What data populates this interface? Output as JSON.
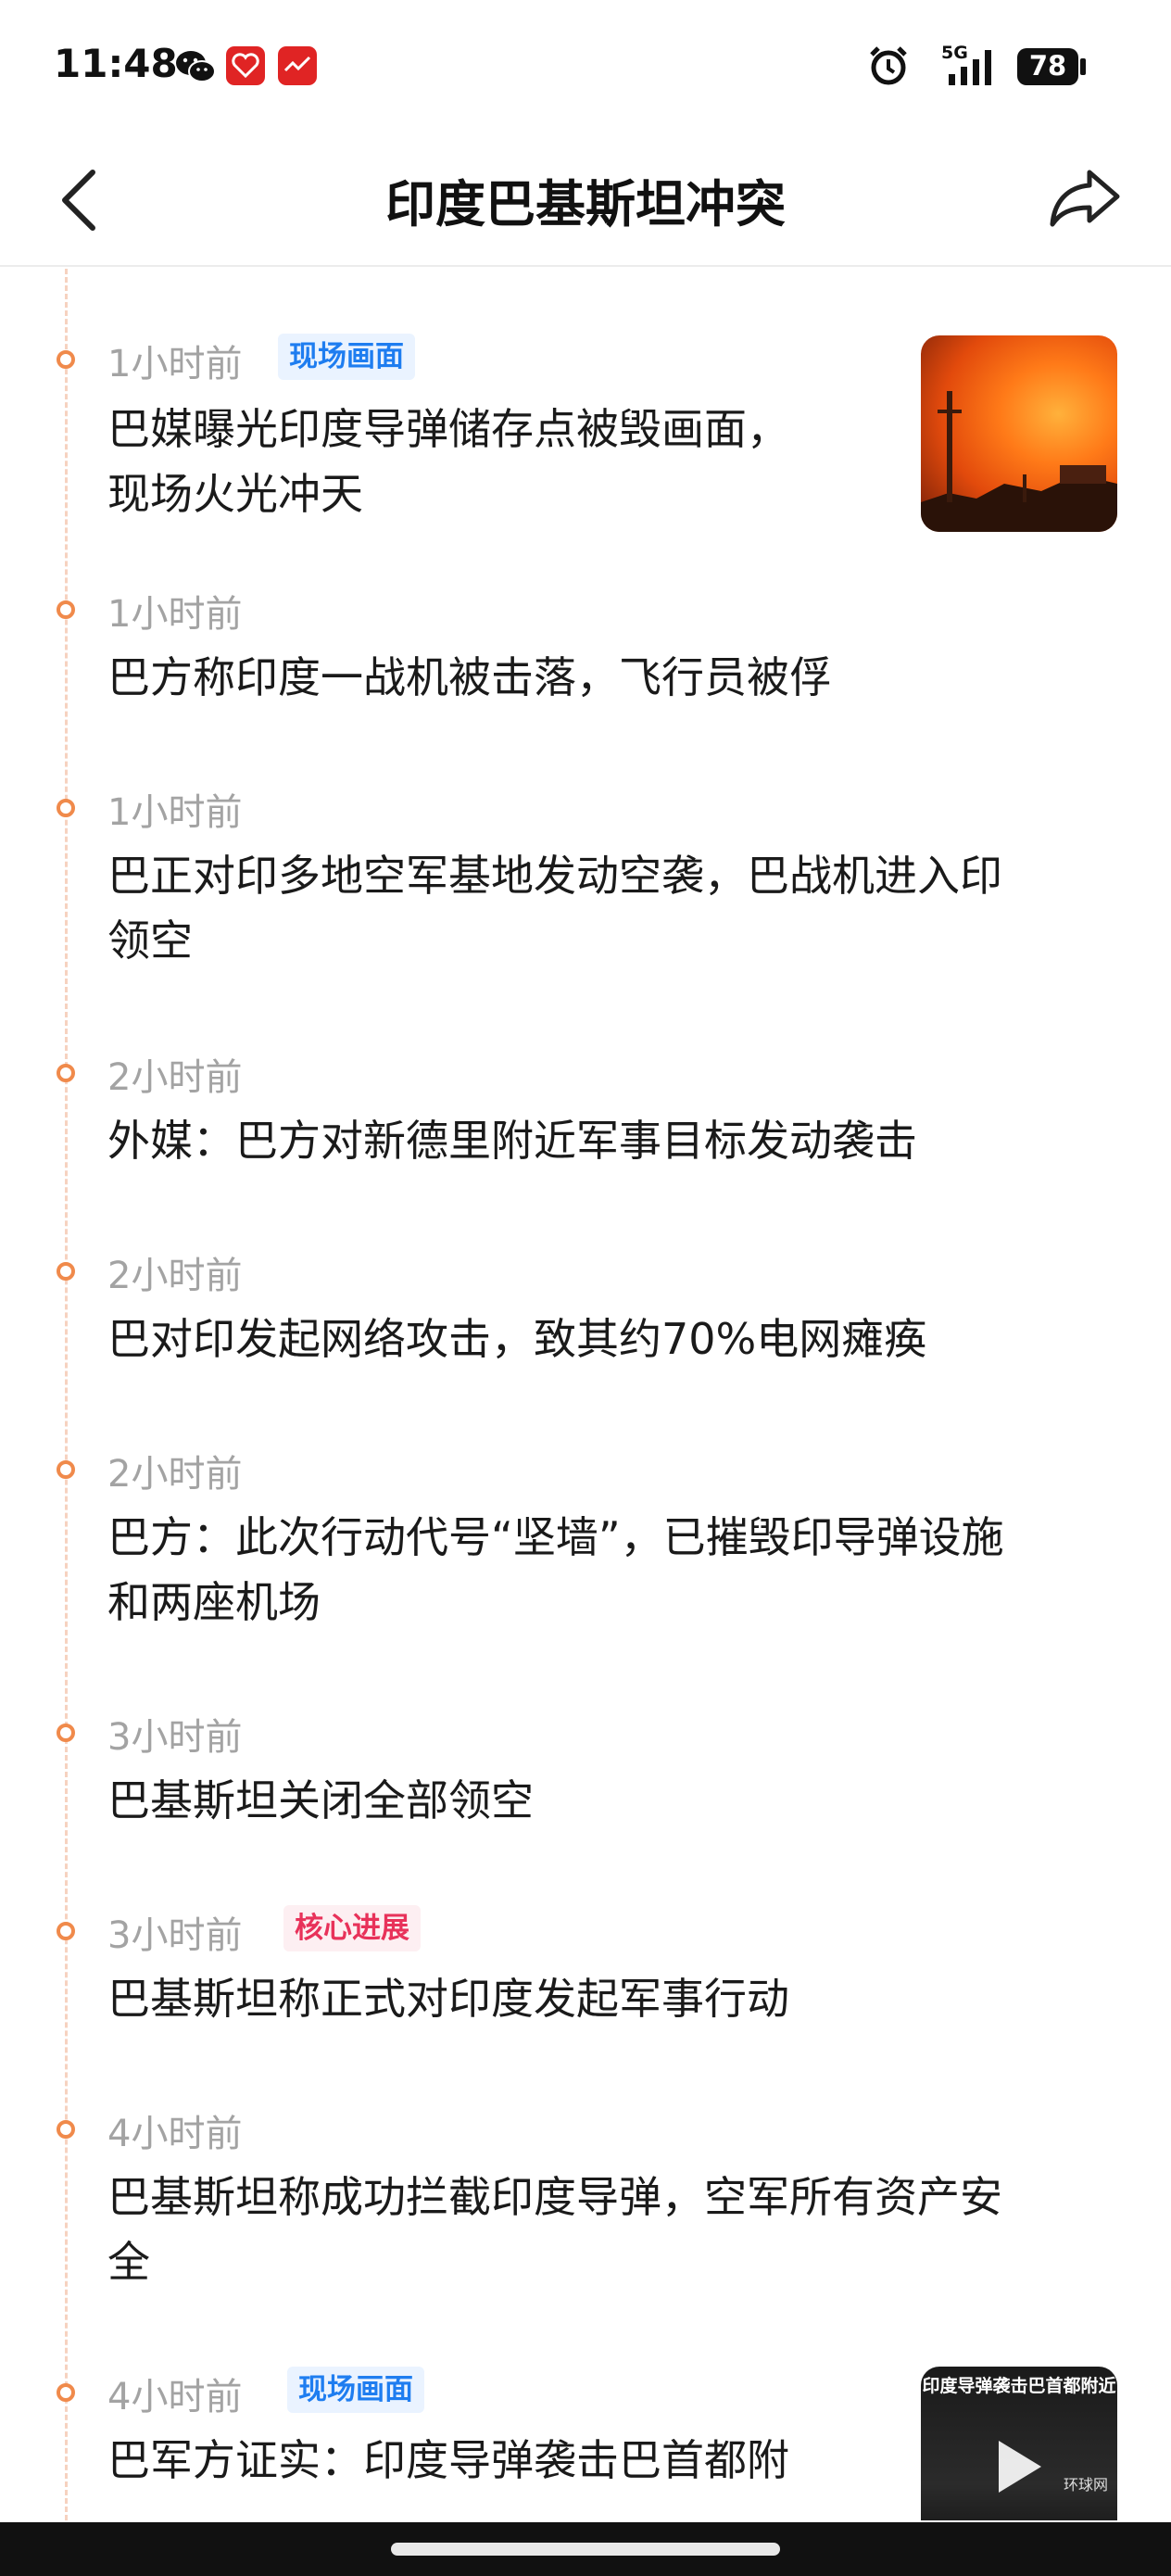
{
  "status_bar": {
    "time": "11:48",
    "network": "5G",
    "battery": "78",
    "icons": [
      "wechat-icon",
      "app-red-icon",
      "app-red-icon",
      "alarm-icon",
      "signal-icon",
      "battery-icon"
    ]
  },
  "header": {
    "title": "印度巴基斯坦冲突",
    "back_icon": "chevron-left-icon",
    "share_icon": "share-icon"
  },
  "timeline": {
    "items": [
      {
        "time": "1小时前",
        "tag": "现场画面",
        "tag_type": "blue",
        "headline_lines": [
          "巴媒曝光印度导弹储存点被毁画面，",
          "现场火光冲天"
        ],
        "thumbnail": "fire"
      },
      {
        "time": "1小时前",
        "headline_lines": [
          "巴方称印度一战机被击落，飞行员被俘"
        ]
      },
      {
        "time": "1小时前",
        "headline_lines": [
          "巴正对印多地空军基地发动空袭，巴战机进入印",
          "领空"
        ]
      },
      {
        "time": "2小时前",
        "headline_lines": [
          "外媒：巴方对新德里附近军事目标发动袭击"
        ]
      },
      {
        "time": "2小时前",
        "headline_lines": [
          "巴对印发起网络攻击，致其约70%电网瘫痪"
        ]
      },
      {
        "time": "2小时前",
        "headline_lines": [
          "巴方：此次行动代号“坚墙”，已摧毁印导弹设施",
          "和两座机场"
        ]
      },
      {
        "time": "3小时前",
        "headline_lines": [
          "巴基斯坦关闭全部领空"
        ]
      },
      {
        "time": "3小时前",
        "tag": "核心进展",
        "tag_type": "red",
        "headline_lines": [
          "巴基斯坦称正式对印度发起军事行动"
        ]
      },
      {
        "time": "4小时前",
        "headline_lines": [
          "巴基斯坦称成功拦截印度导弹，空军所有资产安",
          "全"
        ]
      },
      {
        "time": "4小时前",
        "tag": "现场画面",
        "tag_type": "blue",
        "headline_lines": [
          "巴军方证实：印度导弹袭击巴首都附"
        ],
        "thumbnail": "video",
        "thumbnail_caption": "印度导弹袭击巴首都附近",
        "thumbnail_watermark": "环球网"
      }
    ]
  },
  "colors": {
    "accent_dot": "#f08a4b",
    "tag_blue": "#1e7df0",
    "tag_red": "#e8325a",
    "time_gray": "#a3a3a3"
  }
}
